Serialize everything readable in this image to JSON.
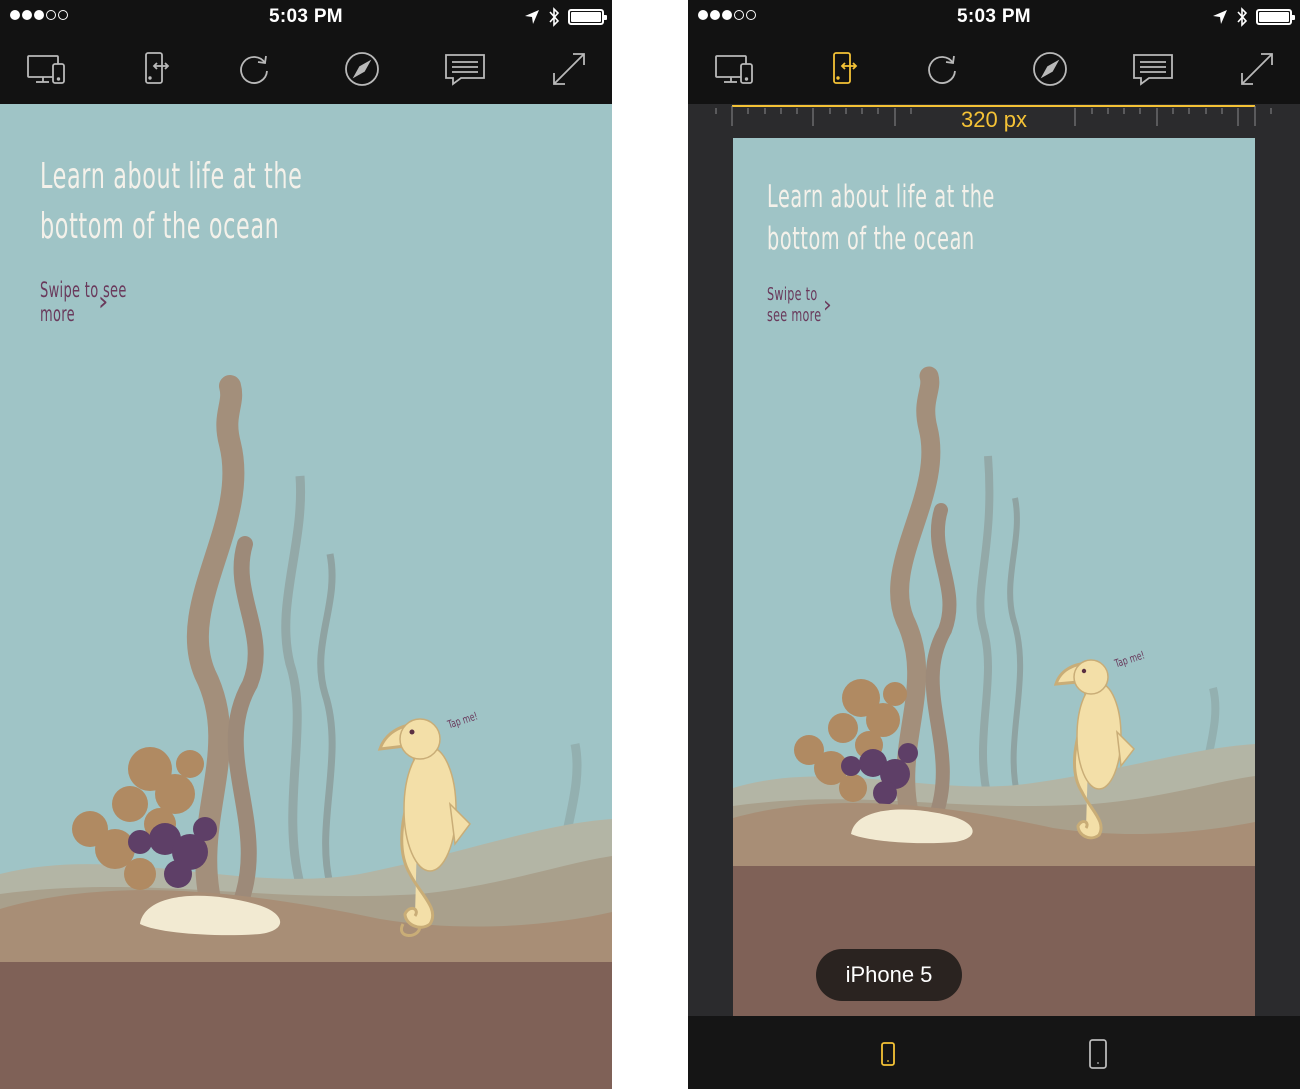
{
  "colors": {
    "toolbar_bg": "#121212",
    "icon": "#b9b9b9",
    "accent": "#f4c236",
    "sea": "#9fc4c6",
    "sand": "#9f8570",
    "seabed": "#7d6055",
    "headline_text": "#f4f1ea",
    "link_text": "#6a3a5c"
  },
  "screens": [
    {
      "status_bar": {
        "signal_bars_filled": 3,
        "signal_bars_total": 5,
        "time": "5:03 PM",
        "icons": [
          "location-arrow-icon",
          "bluetooth-icon"
        ],
        "battery_level": 1.0
      },
      "toolbar": {
        "active_tool": "none",
        "tools": [
          "device-preview-icon",
          "rotate-device-icon",
          "reload-icon",
          "safari-compass-icon",
          "comment-icon",
          "fullscreen-icon"
        ]
      },
      "page": {
        "headline": "Learn about life at the\nbottom of the ocean",
        "swipe_link": "Swipe to see more",
        "tap_me": "Tap me!"
      }
    },
    {
      "status_bar": {
        "signal_bars_filled": 3,
        "signal_bars_total": 5,
        "time": "5:03 PM",
        "icons": [
          "location-arrow-icon",
          "bluetooth-icon"
        ],
        "battery_level": 1.0
      },
      "toolbar": {
        "active_tool": "rotate-device-icon",
        "tools": [
          "device-preview-icon",
          "rotate-device-icon",
          "reload-icon",
          "safari-compass-icon",
          "comment-icon",
          "fullscreen-icon"
        ]
      },
      "ruler": {
        "width_label": "320 px"
      },
      "page": {
        "headline": "Learn about life at the\nbottom of the ocean",
        "swipe_link": "Swipe to see more",
        "tap_me": "Tap me!"
      },
      "device_label": "iPhone 5",
      "bottom_bar": {
        "selected_device": "small-phone-icon",
        "devices": [
          "small-phone-icon",
          "large-phone-icon"
        ]
      }
    }
  ]
}
